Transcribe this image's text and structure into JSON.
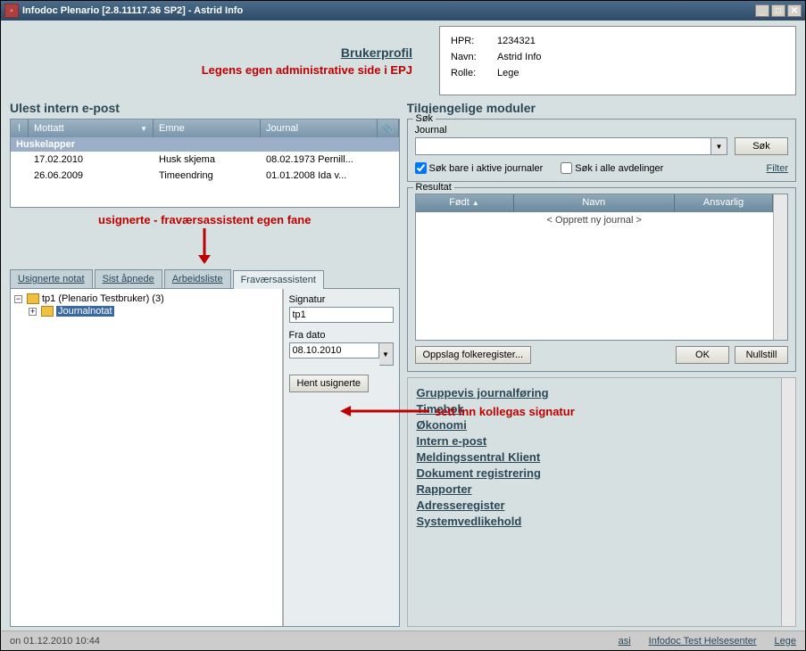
{
  "window": {
    "title": "Infodoc Plenario [2.8.11117.36 SP2] - Astrid Info"
  },
  "profile": {
    "heading": "Brukerprofil",
    "red_note": "Legens egen administrative side i EPJ",
    "hpr_label": "HPR:",
    "hpr_value": "1234321",
    "navn_label": "Navn:",
    "navn_value": "Astrid Info",
    "rolle_label": "Rolle:",
    "rolle_value": "Lege"
  },
  "email": {
    "section_title": "Ulest intern e-post",
    "col_mottatt": "Mottatt",
    "col_emne": "Emne",
    "col_journal": "Journal",
    "group": "Huskelapper",
    "rows": [
      {
        "date": "17.02.2010",
        "subj": "Husk skjema",
        "jrnl": "08.02.1973 Pernill..."
      },
      {
        "date": "26.06.2009",
        "subj": "Timeendring",
        "jrnl": "01.01.2008 Ida v..."
      }
    ]
  },
  "annot": {
    "tabs_note": "usignerte - fraværsassistent egen fane",
    "sig_note": "sett inn kollegas signatur"
  },
  "tabs": {
    "t1": "Usignerte notat",
    "t2": "Sist åpnede",
    "t3": "Arbeidsliste",
    "t4": "Fraværsassistent"
  },
  "tree": {
    "root": "tp1 (Plenario Testbruker) (3)",
    "child": "Journalnotat"
  },
  "assist": {
    "sig_label": "Signatur",
    "sig_value": "tp1",
    "date_label": "Fra dato",
    "date_value": "08.10.2010",
    "btn": "Hent usignerte"
  },
  "modules": {
    "section_title": "Tilgjengelige moduler"
  },
  "search": {
    "legend": "Søk",
    "journal_label": "Journal",
    "journal_value": "",
    "btn": "Søk",
    "chk1": "Søk bare i aktive journaler",
    "chk2": "Søk i alle avdelinger",
    "filter": "Filter"
  },
  "result": {
    "legend": "Resultat",
    "col_fodt": "Født",
    "col_navn": "Navn",
    "col_ansv": "Ansvarlig",
    "row_new": "< Opprett ny journal >"
  },
  "result_btns": {
    "folke": "Oppslag folkeregister...",
    "ok": "OK",
    "null": "Nullstill"
  },
  "links": {
    "l1": "Gruppevis journalføring",
    "l2": "Timebok",
    "l3": "Økonomi",
    "l4": "Intern e-post",
    "l5": "Meldingssentral Klient",
    "l6": "Dokument registrering",
    "l7": "Rapporter",
    "l8": "Adresseregister",
    "l9": "Systemvedlikehold"
  },
  "status": {
    "time": "on 01.12.2010 10:44",
    "user": "asi",
    "site": "Infodoc Test Helsesenter",
    "role": "Lege"
  }
}
